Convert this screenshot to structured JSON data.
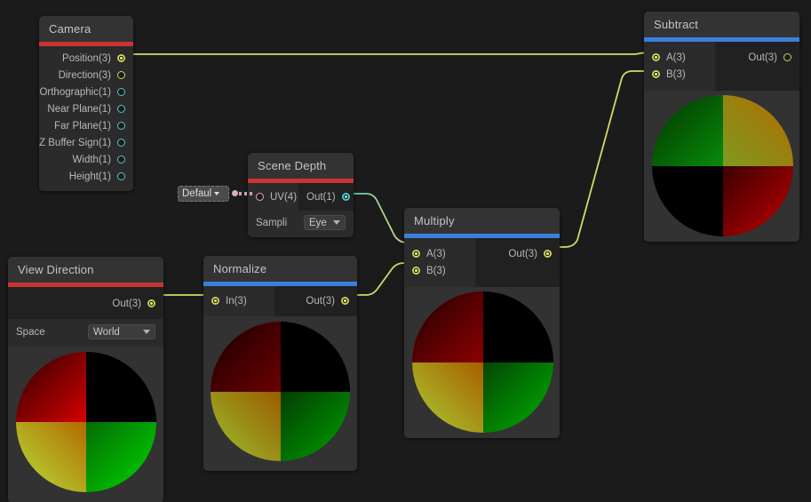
{
  "editor": {
    "background_color": "#1b1b1b",
    "accent_red": "#cc3333",
    "accent_blue": "#3b7fdd",
    "edge_color": "#d6da62",
    "edge_color_float": "#4ec9c9"
  },
  "nodes": {
    "camera": {
      "title": "Camera",
      "accent": "#cc3333",
      "outputs": [
        {
          "label": "Position(3)",
          "type": "vector3",
          "connected": true
        },
        {
          "label": "Direction(3)",
          "type": "vector3",
          "connected": false
        },
        {
          "label": "Orthographic(1)",
          "type": "float",
          "connected": false
        },
        {
          "label": "Near Plane(1)",
          "type": "float",
          "connected": false
        },
        {
          "label": "Far Plane(1)",
          "type": "float",
          "connected": false
        },
        {
          "label": "Z Buffer Sign(1)",
          "type": "float",
          "connected": false
        },
        {
          "label": "Width(1)",
          "type": "float",
          "connected": false
        },
        {
          "label": "Height(1)",
          "type": "float",
          "connected": false
        }
      ]
    },
    "scene_depth": {
      "title": "Scene Depth",
      "accent": "#cc3333",
      "inputs": [
        {
          "label": "UV(4)",
          "type": "vector4",
          "connected": false
        }
      ],
      "outputs": [
        {
          "label": "Out(1)",
          "type": "float",
          "connected": true
        }
      ],
      "uv_default_dropdown": "Defaul",
      "control_label": "Sampli",
      "control_value": "Eye"
    },
    "view_direction": {
      "title": "View Direction",
      "accent": "#cc3333",
      "outputs": [
        {
          "label": "Out(3)",
          "type": "vector3",
          "connected": true
        }
      ],
      "control_label": "Space",
      "control_value": "World",
      "preview": {
        "top_left": [
          "#d60000",
          "#2a0000"
        ],
        "top_right": [
          "#000000",
          "#000000"
        ],
        "bottom_left": [
          "#b26a00",
          "#b6e23a"
        ],
        "bottom_right": [
          "#046b04",
          "#00d900"
        ]
      }
    },
    "normalize": {
      "title": "Normalize",
      "accent": "#3b7fdd",
      "inputs": [
        {
          "label": "In(3)",
          "type": "vector3",
          "connected": true
        }
      ],
      "outputs": [
        {
          "label": "Out(3)",
          "type": "vector3",
          "connected": true
        }
      ],
      "preview": {
        "top_left": [
          "#6b0000",
          "#1a0000"
        ],
        "top_right": [
          "#000000",
          "#000000"
        ],
        "bottom_left": [
          "#9a5c00",
          "#9ac22e"
        ],
        "bottom_right": [
          "#033d03",
          "#00a300"
        ]
      }
    },
    "multiply": {
      "title": "Multiply",
      "accent": "#3b7fdd",
      "inputs": [
        {
          "label": "A(3)",
          "type": "vector3",
          "connected": true
        },
        {
          "label": "B(3)",
          "type": "vector3",
          "connected": true
        }
      ],
      "outputs": [
        {
          "label": "Out(3)",
          "type": "vector3",
          "connected": true
        }
      ],
      "preview": {
        "top_left": [
          "#8a0000",
          "#210000"
        ],
        "top_right": [
          "#000000",
          "#000000"
        ],
        "bottom_left": [
          "#a85e00",
          "#a8d033"
        ],
        "bottom_right": [
          "#044504",
          "#00b300"
        ]
      }
    },
    "subtract": {
      "title": "Subtract",
      "accent": "#3b7fdd",
      "inputs": [
        {
          "label": "A(3)",
          "type": "vector3",
          "connected": true
        },
        {
          "label": "B(3)",
          "type": "vector3",
          "connected": true
        }
      ],
      "outputs": [
        {
          "label": "Out(3)",
          "type": "vector3",
          "connected": false
        }
      ],
      "preview": {
        "top_left": [
          "#0a8a0a",
          "#003400"
        ],
        "top_right": [
          "#7f9a1f",
          "#b26a00"
        ],
        "bottom_left": [
          "#000000",
          "#000000"
        ],
        "bottom_right": [
          "#3a0000",
          "#c40000"
        ]
      }
    }
  },
  "connections": [
    {
      "from": "camera.Position(3)",
      "to": "subtract.A(3)"
    },
    {
      "from": "scene_depth.Out(1)",
      "to": "multiply.A(3)"
    },
    {
      "from": "view_direction.Out(3)",
      "to": "normalize.In(3)"
    },
    {
      "from": "normalize.Out(3)",
      "to": "multiply.B(3)"
    },
    {
      "from": "multiply.Out(3)",
      "to": "subtract.B(3)"
    }
  ]
}
